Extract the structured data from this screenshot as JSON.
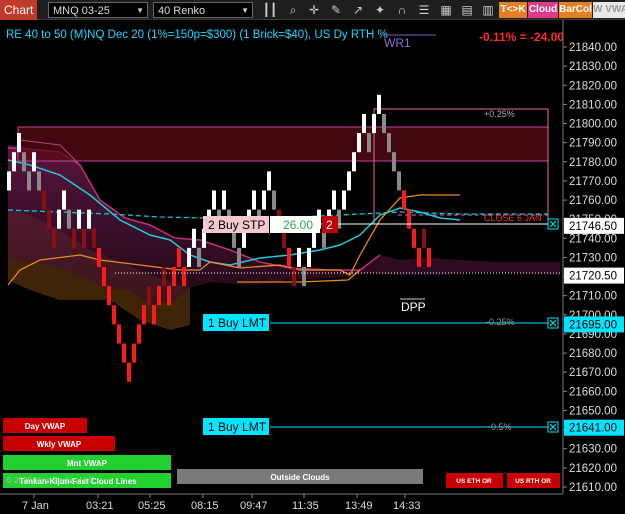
{
  "toolbar": {
    "chart_tab": "Chart",
    "instrument": "MNQ 03-25",
    "bar_type": "40 Renko",
    "buttons": {
      "tk": "T<>K",
      "cloud": "Cloud",
      "barcol": "BarCol",
      "w": "W VWAV"
    },
    "icons": [
      "bars-icon",
      "magnify-icon",
      "crosshair-icon",
      "pencil-icon",
      "arrow-up-icon",
      "wand-icon",
      "magnet-icon",
      "list-icon",
      "grid-icon",
      "tiles-icon",
      "bars2-icon"
    ]
  },
  "chart": {
    "header": "RE 40 to 50 (M)NQ Dec 20 (1%=150p=$300) (1 Brick=$40), US Dy RTH %",
    "pnl": "-0.11% = -24.00",
    "wr1": "WR1",
    "copyright": "© 2025 NinjaTrader, LLC"
  },
  "labels": {
    "pct_top": "+0.25%",
    "close": "CLOSE 6 JAN",
    "dpp": "DPP",
    "pct_m025": "-0.25%",
    "pct_m05": "-0.5%"
  },
  "orders": {
    "buy_stp": "2 Buy STP",
    "stp_pl": "26.00",
    "stp_qty": "2",
    "buy_lmt1": "1 Buy LMT",
    "buy_lmt2": "1 Buy LMT"
  },
  "price_axis": {
    "ticks": [
      "21840.00",
      "21830.00",
      "21820.00",
      "21810.00",
      "21800.00",
      "21790.00",
      "21780.00",
      "21770.00",
      "21760.00",
      "21750.00",
      "21740.00",
      "21730.00",
      "21720.00",
      "21710.00",
      "21700.00",
      "21690.00",
      "21680.00",
      "21670.00",
      "21660.00",
      "21650.00",
      "21640.00",
      "21630.00",
      "21620.00",
      "21610.00"
    ],
    "boxes": [
      {
        "value": "21746.50",
        "color": "#ffffff"
      },
      {
        "value": "21720.50",
        "color": "#ffffff"
      },
      {
        "value": "21695.00",
        "color": "#00e5ff"
      },
      {
        "value": "21641.00",
        "color": "#00e5ff"
      }
    ]
  },
  "time_axis": [
    "7 Jan",
    "03:21",
    "05:25",
    "08:15",
    "09:47",
    "11:35",
    "13:49",
    "14:33"
  ],
  "panel_buttons": {
    "day_vwap": "Day VWAP",
    "wkly_vwap": "Wkly VWAP",
    "mnt_vwap": "Mnt VWAP",
    "tenkan": "Tenkan-Kijun-Fast Cloud Lines",
    "outside_clouds": "Outside Clouds",
    "us_eth": "US ETH OR",
    "us_rth": "US RTH OR"
  },
  "colors": {
    "up_brick": "#ffffff",
    "down_brick": "#ff1a1a",
    "accent_cyan": "#00e5ff",
    "chart_tab": "#c0392b"
  }
}
